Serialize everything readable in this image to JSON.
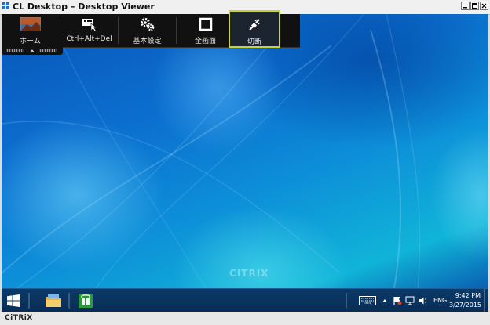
{
  "window": {
    "title": "CL Desktop – Desktop Viewer",
    "controls": [
      "minimize",
      "maximize",
      "close"
    ]
  },
  "toolbar": {
    "buttons": [
      {
        "id": "home",
        "label": "ホーム",
        "icon": "home-thumbnail-icon",
        "active": false
      },
      {
        "id": "cad",
        "label": "Ctrl+Alt+Del",
        "icon": "ctrl-alt-del-icon",
        "active": false
      },
      {
        "id": "prefs",
        "label": "基本設定",
        "icon": "gears-icon",
        "active": false
      },
      {
        "id": "fullscreen",
        "label": "全画面",
        "icon": "fullscreen-icon",
        "active": false
      },
      {
        "id": "disconnect",
        "label": "切断",
        "icon": "plug-disconnect-icon",
        "active": true
      }
    ],
    "highlight_color": "#c8d23a"
  },
  "desktop": {
    "watermark": "CITRIX"
  },
  "taskbar": {
    "apps": [
      "file-explorer-icon",
      "store-icon"
    ],
    "tray": {
      "language": "ENG",
      "time": "9:42 PM",
      "date": "3/27/2015"
    }
  },
  "statusbar": {
    "logo": "CiTRiX"
  }
}
